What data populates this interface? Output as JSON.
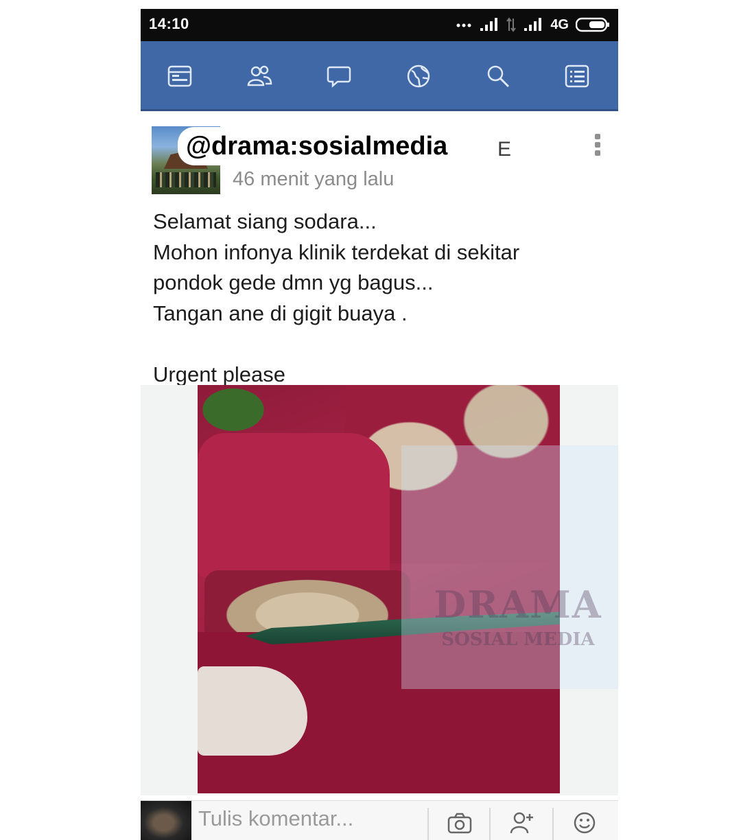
{
  "status_bar": {
    "time": "14:10",
    "network": "4G",
    "icons": [
      "dots-icon",
      "signal-icon",
      "data-arrows-icon",
      "signal-icon",
      "battery-icon"
    ]
  },
  "nav": {
    "color": "#4067a6",
    "items": [
      "news-feed-icon",
      "friends-icon",
      "messages-icon",
      "notifications-globe-icon",
      "search-icon",
      "menu-icon"
    ]
  },
  "post": {
    "author": "E",
    "watermark_handle": "@drama:sosialmedia",
    "time": "46 menit yang lalu",
    "text_lines": [
      "Selamat siang sodara...",
      "Mohon infonya klinik terdekat di sekitar",
      "pondok gede dmn yg bagus...",
      "Tangan ane di gigit buaya .",
      "",
      "Urgent please"
    ],
    "photo_watermark": {
      "title": "DRAMA",
      "subtitle": "SOSIAL MEDIA"
    }
  },
  "comment_bar": {
    "placeholder": "Tulis komentar...",
    "icons": [
      "camera-icon",
      "add-friend-icon",
      "emoji-icon"
    ]
  }
}
